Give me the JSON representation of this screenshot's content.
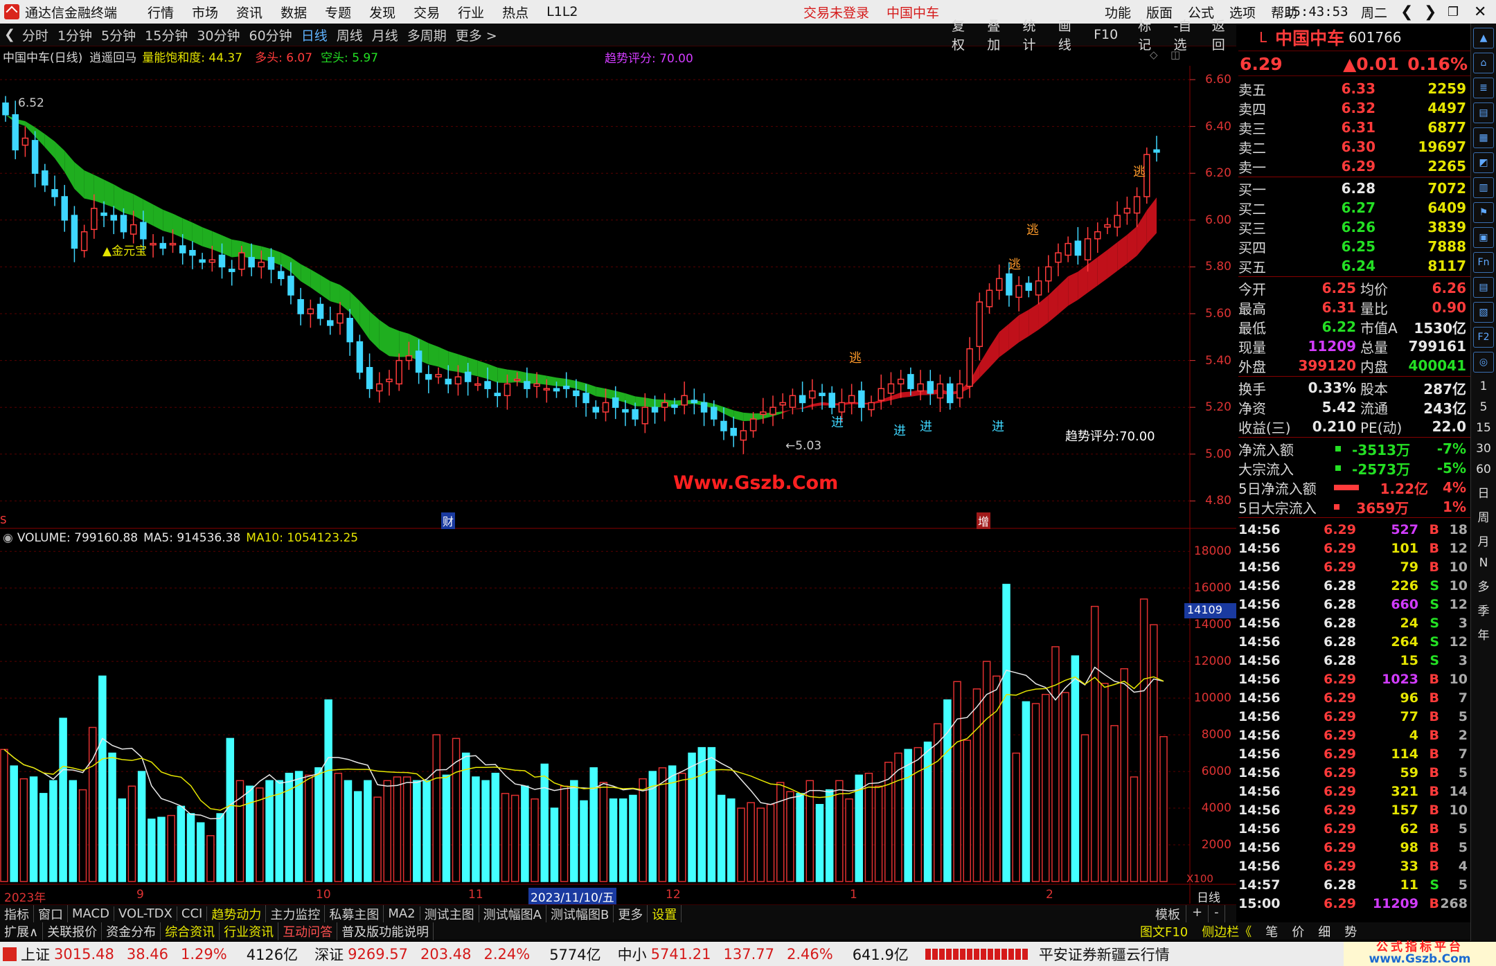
{
  "titlebar": {
    "app": "通达信金融终端",
    "menu": [
      "行情",
      "市场",
      "资讯",
      "数据",
      "专题",
      "发现",
      "交易",
      "行业",
      "热点",
      "L1L2"
    ],
    "login": "交易未登录",
    "stock": "中国中车",
    "right_menu": [
      "功能",
      "版面",
      "公式",
      "选项",
      "帮助"
    ],
    "time": "15:43:53",
    "weekday": "周二"
  },
  "periods": [
    "分时",
    "1分钟",
    "5分钟",
    "15分钟",
    "30分钟",
    "60分钟",
    "日线",
    "周线",
    "月线",
    "多周期",
    "更多 >"
  ],
  "active_period": "日线",
  "chart_buttons": [
    "复权",
    "叠加",
    "统计",
    "画线",
    "F10",
    "标记",
    "-自选",
    "返回"
  ],
  "indicator_line": {
    "name": "中国中车(日线)",
    "formula": "逍遥回马",
    "energy": "量能饱和度: 44.37",
    "bull": "多头: 6.07",
    "bear": "空头: 5.97",
    "score": "趋势评分: 70.00"
  },
  "price_axis": [
    "6.60",
    "6.40",
    "6.20",
    "6.00",
    "5.80",
    "5.60",
    "5.40",
    "5.20",
    "5.00",
    "4.80"
  ],
  "annotations": {
    "high": "6.52",
    "low": "←5.03",
    "gold": "▲金元宝",
    "escape": "逃",
    "enter": "进",
    "score": "趋势评分:70.00",
    "watermark": "Www.Gszb.Com",
    "cai": "财",
    "zeng": "增",
    "s": "S"
  },
  "volume_line": {
    "vol": "VOLUME: 799160.88",
    "ma5": "MA5: 914536.38",
    "ma10": "MA10: 1054123.25"
  },
  "volume_axis": [
    "18000",
    "16000",
    "14000",
    "12000",
    "10000",
    "8000",
    "6000",
    "4000",
    "2000"
  ],
  "volume_cursor": "14109",
  "volume_unit": "X100",
  "date_axis": [
    "2023年",
    "9",
    "10",
    "11",
    "2023/11/10/五",
    "12",
    "1",
    "2",
    "日线"
  ],
  "bottom_tabs": [
    "指标",
    "窗口",
    "MACD",
    "VOL-TDX",
    "CCI",
    "趋势动力",
    "主力监控",
    "私募主图",
    "MA2",
    "测试主图",
    "测试幅图A",
    "测试幅图B",
    "更多",
    "设置"
  ],
  "bottom_right": [
    "模板",
    "+",
    "-"
  ],
  "expand_bar": [
    "扩展∧",
    "关联报价",
    "资金分布",
    "综合资讯",
    "行业资讯",
    "互动问答",
    "普及版功能说明"
  ],
  "expand_right": [
    "图文F10",
    "侧边栏《",
    "笔",
    "价",
    "细",
    "势"
  ],
  "quote": {
    "code": "601766",
    "name": "中国中车",
    "price": "6.29",
    "change": "▲0.01",
    "pct": "0.16%",
    "asks": [
      [
        "卖五",
        "6.33",
        "2259"
      ],
      [
        "卖四",
        "6.32",
        "4497"
      ],
      [
        "卖三",
        "6.31",
        "6877"
      ],
      [
        "卖二",
        "6.30",
        "19697"
      ],
      [
        "卖一",
        "6.29",
        "2265"
      ]
    ],
    "bids": [
      [
        "买一",
        "6.28",
        "7072"
      ],
      [
        "买二",
        "6.27",
        "6409"
      ],
      [
        "买三",
        "6.26",
        "3839"
      ],
      [
        "买四",
        "6.25",
        "7888"
      ],
      [
        "买五",
        "6.24",
        "8117"
      ]
    ],
    "stats": [
      [
        "今开",
        "6.25",
        "均价",
        "6.26"
      ],
      [
        "最高",
        "6.31",
        "量比",
        "0.90"
      ],
      [
        "最低",
        "6.22",
        "市值A",
        "1530亿"
      ],
      [
        "现量",
        "11209",
        "总量",
        "799161"
      ],
      [
        "外盘",
        "399120",
        "内盘",
        "400041"
      ]
    ],
    "stats2": [
      [
        "换手",
        "0.33%",
        "股本",
        "287亿"
      ],
      [
        "净资",
        "5.42",
        "流通",
        "243亿"
      ],
      [
        "收益(三)",
        "0.210",
        "PE(动)",
        "22.0"
      ]
    ],
    "flows": [
      [
        "净流入额",
        "-3513万",
        "-7%"
      ],
      [
        "大宗流入",
        "-2573万",
        "-5%"
      ],
      [
        "5日净流入额",
        "1.22亿",
        "4%"
      ],
      [
        "5日大宗流入",
        "3659万",
        "1%"
      ]
    ]
  },
  "ticks": [
    [
      "14:56",
      "6.29",
      "527",
      "B",
      "18"
    ],
    [
      "14:56",
      "6.29",
      "101",
      "B",
      "12"
    ],
    [
      "14:56",
      "6.29",
      "79",
      "B",
      "10"
    ],
    [
      "14:56",
      "6.28",
      "226",
      "S",
      "10"
    ],
    [
      "14:56",
      "6.28",
      "660",
      "S",
      "12"
    ],
    [
      "14:56",
      "6.28",
      "24",
      "S",
      "3"
    ],
    [
      "14:56",
      "6.28",
      "264",
      "S",
      "12"
    ],
    [
      "14:56",
      "6.28",
      "15",
      "S",
      "3"
    ],
    [
      "14:56",
      "6.29",
      "1023",
      "B",
      "10"
    ],
    [
      "14:56",
      "6.29",
      "96",
      "B",
      "7"
    ],
    [
      "14:56",
      "6.29",
      "77",
      "B",
      "5"
    ],
    [
      "14:56",
      "6.29",
      "4",
      "B",
      "2"
    ],
    [
      "14:56",
      "6.29",
      "114",
      "B",
      "7"
    ],
    [
      "14:56",
      "6.29",
      "59",
      "B",
      "5"
    ],
    [
      "14:56",
      "6.29",
      "321",
      "B",
      "14"
    ],
    [
      "14:56",
      "6.29",
      "157",
      "B",
      "10"
    ],
    [
      "14:56",
      "6.29",
      "62",
      "B",
      "5"
    ],
    [
      "14:56",
      "6.29",
      "98",
      "B",
      "5"
    ],
    [
      "14:56",
      "6.29",
      "33",
      "B",
      "4"
    ],
    [
      "14:57",
      "6.28",
      "11",
      "S",
      "5"
    ],
    [
      "15:00",
      "6.29",
      "11209",
      "B",
      "268"
    ]
  ],
  "strip_items": [
    "1",
    "5",
    "15",
    "30",
    "60",
    "日",
    "周",
    "月",
    "N",
    "多",
    "季",
    "年"
  ],
  "statusbar": {
    "sh": "上证",
    "sh_v": "3015.48",
    "sh_c": "38.46",
    "sh_p": "1.29%",
    "sh_a": "4126亿",
    "sz": "深证",
    "sz_v": "9269.57",
    "sz_c": "203.48",
    "sz_p": "2.24%",
    "sz_a": "5774亿",
    "zx": "中小",
    "zx_v": "5741.21",
    "zx_c": "137.77",
    "zx_p": "2.46%",
    "zx_a": "641.9亿",
    "broker": "平安证券新疆云行情",
    "wm": "公式指标平台",
    "wm2": "www.Gszb.Com"
  },
  "chart_data": {
    "type": "candlestick",
    "title": "中国中车(日线)",
    "ylim": [
      4.8,
      6.6
    ],
    "volume_ylim": [
      0,
      18000
    ],
    "close": [
      6.45,
      6.3,
      6.35,
      6.2,
      6.15,
      6.1,
      6.0,
      5.88,
      5.95,
      6.05,
      6.02,
      6.0,
      5.95,
      5.98,
      5.92,
      5.9,
      5.88,
      5.9,
      5.86,
      5.85,
      5.82,
      5.83,
      5.8,
      5.78,
      5.86,
      5.8,
      5.82,
      5.79,
      5.75,
      5.68,
      5.6,
      5.62,
      5.58,
      5.55,
      5.6,
      5.48,
      5.35,
      5.28,
      5.3,
      5.32,
      5.4,
      5.42,
      5.35,
      5.32,
      5.34,
      5.3,
      5.33,
      5.31,
      5.3,
      5.28,
      5.25,
      5.3,
      5.32,
      5.28,
      5.3,
      5.28,
      5.27,
      5.28,
      5.25,
      5.22,
      5.18,
      5.22,
      5.2,
      5.18,
      5.15,
      5.2,
      5.18,
      5.22,
      5.2,
      5.25,
      5.22,
      5.18,
      5.15,
      5.1,
      5.08,
      5.1,
      5.15,
      5.18,
      5.2,
      5.22,
      5.25,
      5.22,
      5.27,
      5.25,
      5.2,
      5.22,
      5.25,
      5.2,
      5.22,
      5.28,
      5.3,
      5.32,
      5.28,
      5.3,
      5.26,
      5.3,
      5.22,
      5.3,
      5.45,
      5.65,
      5.7,
      5.75,
      5.68,
      5.72,
      5.7,
      5.74,
      5.8,
      5.86,
      5.9,
      5.85,
      5.92,
      5.95,
      5.98,
      6.02,
      6.05,
      6.1,
      6.28,
      6.29
    ],
    "volume": [
      7200,
      6300,
      5600,
      5700,
      4800,
      5500,
      8900,
      5500,
      5000,
      8400,
      11200,
      7000,
      4500,
      5200,
      6000,
      3400,
      3500,
      3600,
      4100,
      3700,
      3200,
      2500,
      3700,
      7800,
      5500,
      5200,
      5100,
      5500,
      5500,
      5900,
      6000,
      5800,
      6200,
      9900,
      5900,
      5500,
      4900,
      5500,
      4600,
      5500,
      5700,
      5700,
      5500,
      5500,
      8000,
      5800,
      7800,
      7000,
      5700,
      5500,
      5900,
      4800,
      4700,
      5200,
      4500,
      6400,
      4000,
      5200,
      5500,
      4400,
      6200,
      5400,
      4500,
      4500,
      4700,
      5600,
      6000,
      6200,
      6300,
      5900,
      7000,
      7300,
      7300,
      4700,
      4500,
      4000,
      4300,
      4000,
      4200,
      5400,
      4900,
      4800,
      5500,
      4200,
      5000,
      5500,
      4500,
      5800,
      5900,
      5200,
      6500,
      7000,
      7200,
      7300,
      7600,
      8600,
      9900,
      10900,
      7700,
      10500,
      12000,
      11200,
      16200,
      7000,
      9800,
      9700,
      10200,
      12800,
      10300,
      12300,
      8000,
      15000,
      10800,
      8500,
      11600,
      5700,
      15400,
      14000,
      7900
    ],
    "series": [
      {
        "name": "多头",
        "value": 6.07
      },
      {
        "name": "空头",
        "value": 5.97
      }
    ]
  }
}
